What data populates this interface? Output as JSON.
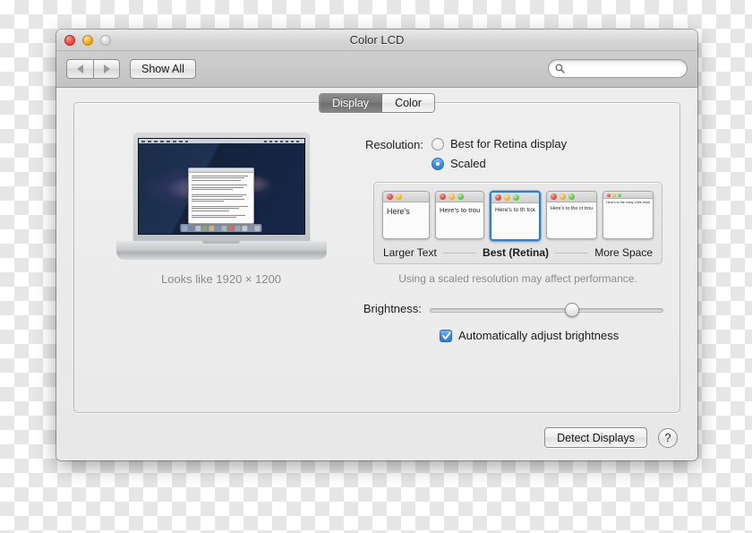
{
  "window": {
    "title": "Color LCD",
    "traffic_lights": [
      "close",
      "minimize",
      "zoom"
    ]
  },
  "toolbar": {
    "back_icon": "triangle-left-icon",
    "forward_icon": "triangle-right-icon",
    "show_all_label": "Show All",
    "search": {
      "value": "",
      "placeholder": "",
      "icon": "search-icon"
    }
  },
  "tabs": [
    {
      "label": "Display",
      "selected": true
    },
    {
      "label": "Color",
      "selected": false
    }
  ],
  "preview": {
    "device": "macbook-pro-retina",
    "caption": "Looks like 1920 × 1200"
  },
  "resolution": {
    "label": "Resolution:",
    "options": [
      {
        "label": "Best for Retina display",
        "selected": false
      },
      {
        "label": "Scaled",
        "selected": true
      }
    ]
  },
  "scaled": {
    "thumbnails": [
      {
        "text": "Here's",
        "selected": false
      },
      {
        "text": "Here's to troublem",
        "selected": false
      },
      {
        "text": "Here's to th troublemak ones who s",
        "selected": true
      },
      {
        "text": "Here's to the cr troublemakers. ones who see t rules. And they",
        "selected": false
      },
      {
        "text": "Here's to the crazy ones troublemakers. The rou ones who see things diff rules. And they have no can quote them, disagre them. About the only th Because they change th",
        "selected": false
      }
    ],
    "left_label": "Larger Text",
    "middle_label": "Best (Retina)",
    "right_label": "More Space",
    "note": "Using a scaled resolution may affect performance."
  },
  "brightness": {
    "label": "Brightness:",
    "value_percent": 60,
    "auto_adjust": {
      "label": "Automatically adjust brightness",
      "checked": true
    }
  },
  "footer": {
    "detect_displays_label": "Detect Displays",
    "help_label": "?"
  },
  "colors": {
    "accent": "#2f7fd1",
    "window_bg": "#ececec",
    "muted_text": "#8a8a8a"
  }
}
